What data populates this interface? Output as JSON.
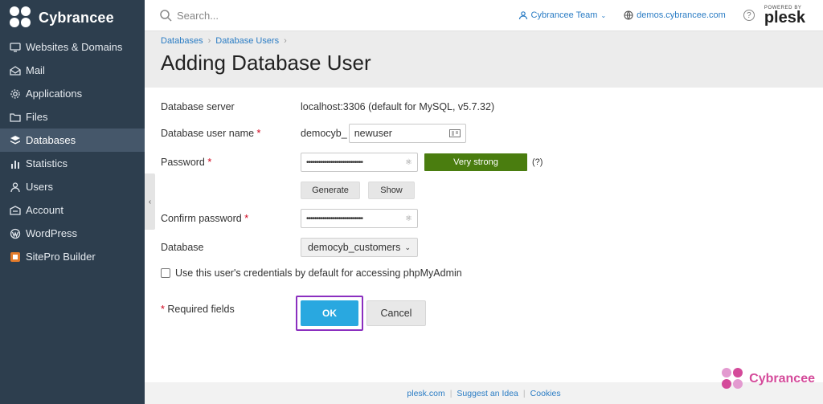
{
  "brand": {
    "name": "Cybrancee"
  },
  "sidebar": {
    "items": [
      {
        "label": "Websites & Domains",
        "icon": "monitor-icon"
      },
      {
        "label": "Mail",
        "icon": "mail-icon"
      },
      {
        "label": "Applications",
        "icon": "gear-icon"
      },
      {
        "label": "Files",
        "icon": "folder-icon"
      },
      {
        "label": "Databases",
        "icon": "database-icon",
        "active": true
      },
      {
        "label": "Statistics",
        "icon": "bar-chart-icon"
      },
      {
        "label": "Users",
        "icon": "user-icon"
      },
      {
        "label": "Account",
        "icon": "account-icon"
      },
      {
        "label": "WordPress",
        "icon": "wordpress-icon"
      },
      {
        "label": "SitePro Builder",
        "icon": "sitepro-icon"
      }
    ]
  },
  "topbar": {
    "search_placeholder": "Search...",
    "team": "Cybrancee Team",
    "domain": "demos.cybrancee.com",
    "help": "?",
    "powered_by": "POWERED BY",
    "plesk": "plesk"
  },
  "breadcrumb": [
    "Databases",
    "Database Users"
  ],
  "page_title": "Adding Database User",
  "form": {
    "server_label": "Database server",
    "server_value": "localhost:3306 (default for MySQL, v5.7.32)",
    "username_label": "Database user name",
    "username_prefix": "democyb_",
    "username_value": "newuser",
    "password_label": "Password",
    "password_dots": "••••••••••••••••••••••••••••",
    "strength": "Very strong",
    "strength_help": "(?)",
    "generate": "Generate",
    "show": "Show",
    "confirm_label": "Confirm password",
    "confirm_dots": "••••••••••••••••••••••••••••",
    "database_label": "Database",
    "database_value": "democyb_customers",
    "checkbox_label": "Use this user's credentials by default for accessing phpMyAdmin",
    "required_note": "* Required fields",
    "required_marker": "*",
    "ok": "OK",
    "cancel": "Cancel"
  },
  "footer": [
    "plesk.com",
    "Suggest an Idea",
    "Cookies"
  ],
  "watermark": "Cybrancee",
  "colors": {
    "sidebar_bg": "#2d3e4e",
    "accent_blue": "#29a8e0",
    "strength_green": "#4a7d0f",
    "highlight_purple": "#8b2fbf",
    "watermark_pink": "#d44a9a"
  }
}
